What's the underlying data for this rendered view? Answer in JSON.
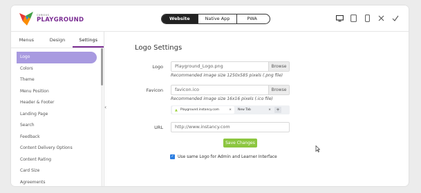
{
  "app": {
    "logo_small": "CURIOUS",
    "logo_big": "PLAYGROUND"
  },
  "modes": [
    "Website",
    "Native App",
    "PWA"
  ],
  "toolbar": {
    "icons": [
      "desktop-icon",
      "tablet-icon",
      "mobile-icon",
      "close-icon",
      "check-icon"
    ]
  },
  "sidebar": {
    "tabs": [
      "Menus",
      "Design",
      "Settings"
    ],
    "active_tab": "Settings",
    "items": [
      "Logo",
      "Colors",
      "Theme",
      "Menu Position",
      "Header & Footer",
      "Landing Page",
      "Search",
      "Feedback",
      "Content Delivery Options",
      "Content Rating",
      "Card Size",
      "Agreements"
    ],
    "active_item": "Logo"
  },
  "main": {
    "title": "Logo Settings",
    "logo": {
      "label": "Logo",
      "value": "Playground_Logo.png",
      "button": "Browse",
      "hint": "Recommended image size 1250x585 pixels (.png file)"
    },
    "favicon": {
      "label": "Favicon",
      "value": "favicon.ico",
      "button": "Browse",
      "hint": "Recommended image size 16x16 pixels (.ico file)"
    },
    "preview": {
      "tab1": "Playground.instancy.com",
      "tab2": "New Tab",
      "close": "×",
      "plus": "+"
    },
    "url": {
      "label": "URL",
      "value": "http://www.instancy.com"
    },
    "save_button": "Save Changes",
    "checkbox_label": "Use same Logo for Admin and Learner Interface"
  },
  "colors": {
    "accent": "#7a2c92",
    "active_item_bg": "#a89ae0",
    "save_green": "#8cc63f",
    "checkbox_blue": "#2a7de1"
  }
}
